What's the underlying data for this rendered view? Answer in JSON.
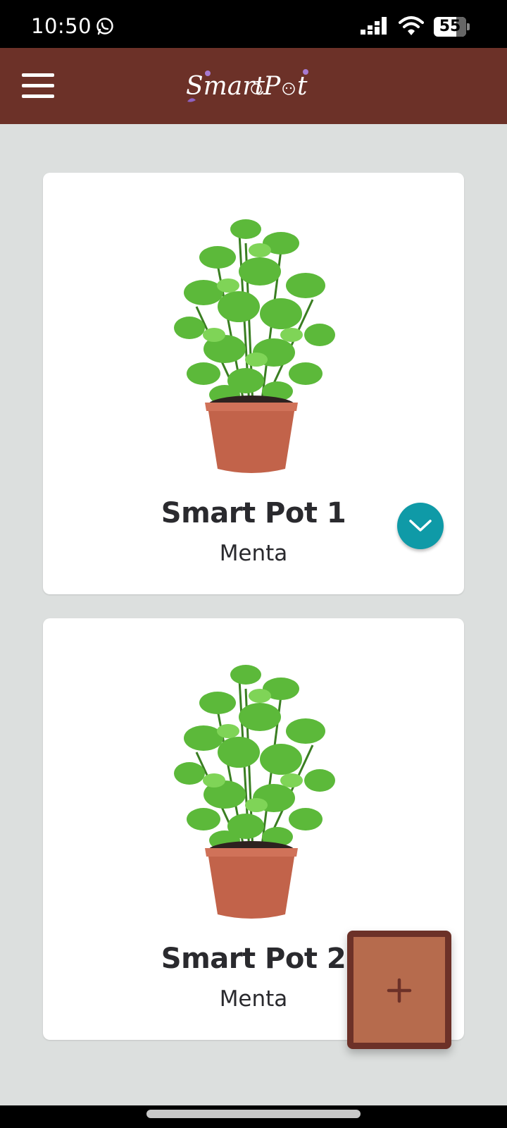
{
  "status_bar": {
    "time": "10:50",
    "battery": "55",
    "icons": [
      "whatsapp-icon",
      "signal-icon",
      "wifi-icon",
      "battery-icon"
    ]
  },
  "header": {
    "logo_text": "Smart Pot",
    "menu_icon": "hamburger-menu-icon",
    "background": "#6c3128"
  },
  "pots": [
    {
      "title": "Smart Pot 1",
      "plant": "Menta",
      "expand_icon": "chevron-down-icon"
    },
    {
      "title": "Smart Pot 2",
      "plant": "Menta"
    }
  ],
  "fab": {
    "icon": "plus-icon",
    "color": "#b66b4d",
    "border": "#6c3128"
  },
  "accent_color": "#0f9aa7"
}
